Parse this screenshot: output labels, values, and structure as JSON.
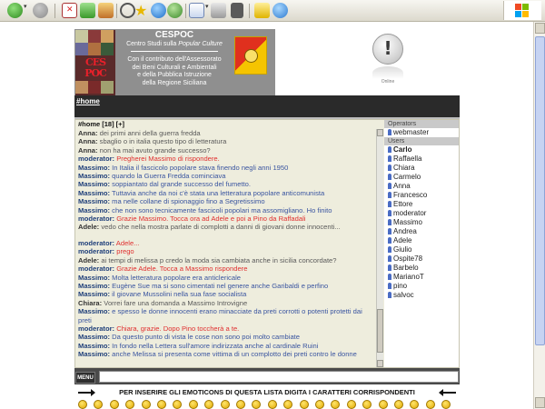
{
  "browser": {
    "toolbar_icons": [
      "back-icon",
      "forward-icon",
      "stop-icon",
      "refresh-icon",
      "home-icon",
      "search-icon",
      "favorites-icon",
      "media-icon",
      "history-icon",
      "mail-icon",
      "print-icon",
      "edit-icon",
      "discuss-icon",
      "messenger-icon"
    ]
  },
  "header": {
    "banner_title": "CESPOC",
    "banner_subtitle_prefix": "Centro Studi sulla ",
    "banner_subtitle_em": "Popular Culture",
    "banner_lines": [
      "Con il contributo dell'Assessorato",
      "dei Beni Culturali e Ambientali",
      "e della Pubblica Istruzione",
      "della Regione Siciliana"
    ],
    "logo_word_top": "CES",
    "logo_word_bottom": "POC",
    "online_glyph": "!",
    "online_label": "Online"
  },
  "channel": {
    "tab_label": "#home",
    "header": "#home [18] [+]"
  },
  "messages": [
    {
      "nick": "Anna:",
      "text": "dei primi anni della guerra fredda",
      "type": "user"
    },
    {
      "nick": "Anna:",
      "text": "sbaglio o in italia questo tipo di letteratura",
      "type": "user"
    },
    {
      "nick": "Anna:",
      "text": "non ha mai avuto grande successo?",
      "type": "user"
    },
    {
      "nick": "moderator:",
      "text": "Pregherei Massimo di rispondere.",
      "type": "mod"
    },
    {
      "nick": "Massimo:",
      "text": "In Italia il fascicolo popolare stava finendo negli anni 1950",
      "type": "massimo"
    },
    {
      "nick": "Massimo:",
      "text": "quando la Guerra Fredda cominciava",
      "type": "massimo"
    },
    {
      "nick": "Massimo:",
      "text": "soppiantato dal grande successo del fumetto.",
      "type": "massimo"
    },
    {
      "nick": "Massimo:",
      "text": "Tuttavia anche da noi c'è stata una letteratura popolare anticomunista",
      "type": "massimo"
    },
    {
      "nick": "Massimo:",
      "text": "ma nelle collane di spionaggio fino a Segretissimo",
      "type": "massimo"
    },
    {
      "nick": "Massimo:",
      "text": "che non sono tecnicamente fascicoli popolari ma assomigliano. Ho finito",
      "type": "massimo"
    },
    {
      "nick": "moderator:",
      "text": "Grazie Massimo. Tocca ora ad Adele e poi a Pino da Raffadali",
      "type": "mod"
    },
    {
      "nick": "Adele:",
      "text": "vedo che nella mostra parlate di complotti a danni di giovani donne innocenti...",
      "type": "user"
    },
    {
      "nick": "",
      "text": "",
      "type": "spacer"
    },
    {
      "nick": "moderator:",
      "text": "Adele...",
      "type": "mod"
    },
    {
      "nick": "moderator:",
      "text": "prego",
      "type": "mod"
    },
    {
      "nick": "Adele:",
      "text": "ai tempi di melissa p credo la moda sia cambiata anche in sicilia  concordate?",
      "type": "user"
    },
    {
      "nick": "moderator:",
      "text": "Grazie Adele. Tocca a Massimo rispondere",
      "type": "mod"
    },
    {
      "nick": "Massimo:",
      "text": "Molta letteratura popolare era anticlericale",
      "type": "massimo"
    },
    {
      "nick": "Massimo:",
      "text": "Eugène Sue ma si sono cimentati nel genere anche Garibaldi e perfino",
      "type": "massimo"
    },
    {
      "nick": "Massimo:",
      "text": "il giovane Mussolini nella sua fase socialista",
      "type": "massimo"
    },
    {
      "nick": "Chiara:",
      "text": "Vorrei fare una domanda a Massimo Introvigne",
      "type": "user"
    },
    {
      "nick": "Massimo:",
      "text": "e spesso le donne innocenti erano minacciate da preti corrotti o potenti protetti dai preti",
      "type": "massimo"
    },
    {
      "nick": "moderator:",
      "text": "Chiara, grazie. Dopo Pino toccherà a te.",
      "type": "mod"
    },
    {
      "nick": "Massimo:",
      "text": "Da questo punto di vista le cose non sono poi molto cambiate",
      "type": "massimo"
    },
    {
      "nick": "Massimo:",
      "text": "In fondo nella Lettera sull'amore indirizzata anche al cardinale Ruini",
      "type": "massimo"
    },
    {
      "nick": "Massimo:",
      "text": "anche Melissa si presenta come vittima di un complotto dei preti contro le donne",
      "type": "massimo"
    }
  ],
  "users_panel": {
    "operators_label": "Operators",
    "operators": [
      "webmaster"
    ],
    "users_label": "Users",
    "users": [
      "Carlo",
      "Raffaella",
      "Chiara",
      "Carmelo",
      "Anna",
      "Francesco",
      "Ettore",
      "moderator",
      "Massimo",
      "Andrea",
      "Adele",
      "Giulio",
      "Ospite78",
      "Barbelo",
      "MarianoT",
      "pino",
      "salvoc"
    ],
    "current_user": "Carlo"
  },
  "input": {
    "menu_label": "MENU",
    "value": ""
  },
  "emoticons": {
    "instruction": "PER INSERIRE GLI EMOTICONS DI QUESTA LISTA DIGITA I CARATTERI CORRISPONDENTI",
    "count": 24
  },
  "colors": {
    "chat_bg": "#eeeddd",
    "moderator_text": "#e03030",
    "massimo_text": "#3a55a0",
    "tabbar": "#2a2a2a"
  }
}
